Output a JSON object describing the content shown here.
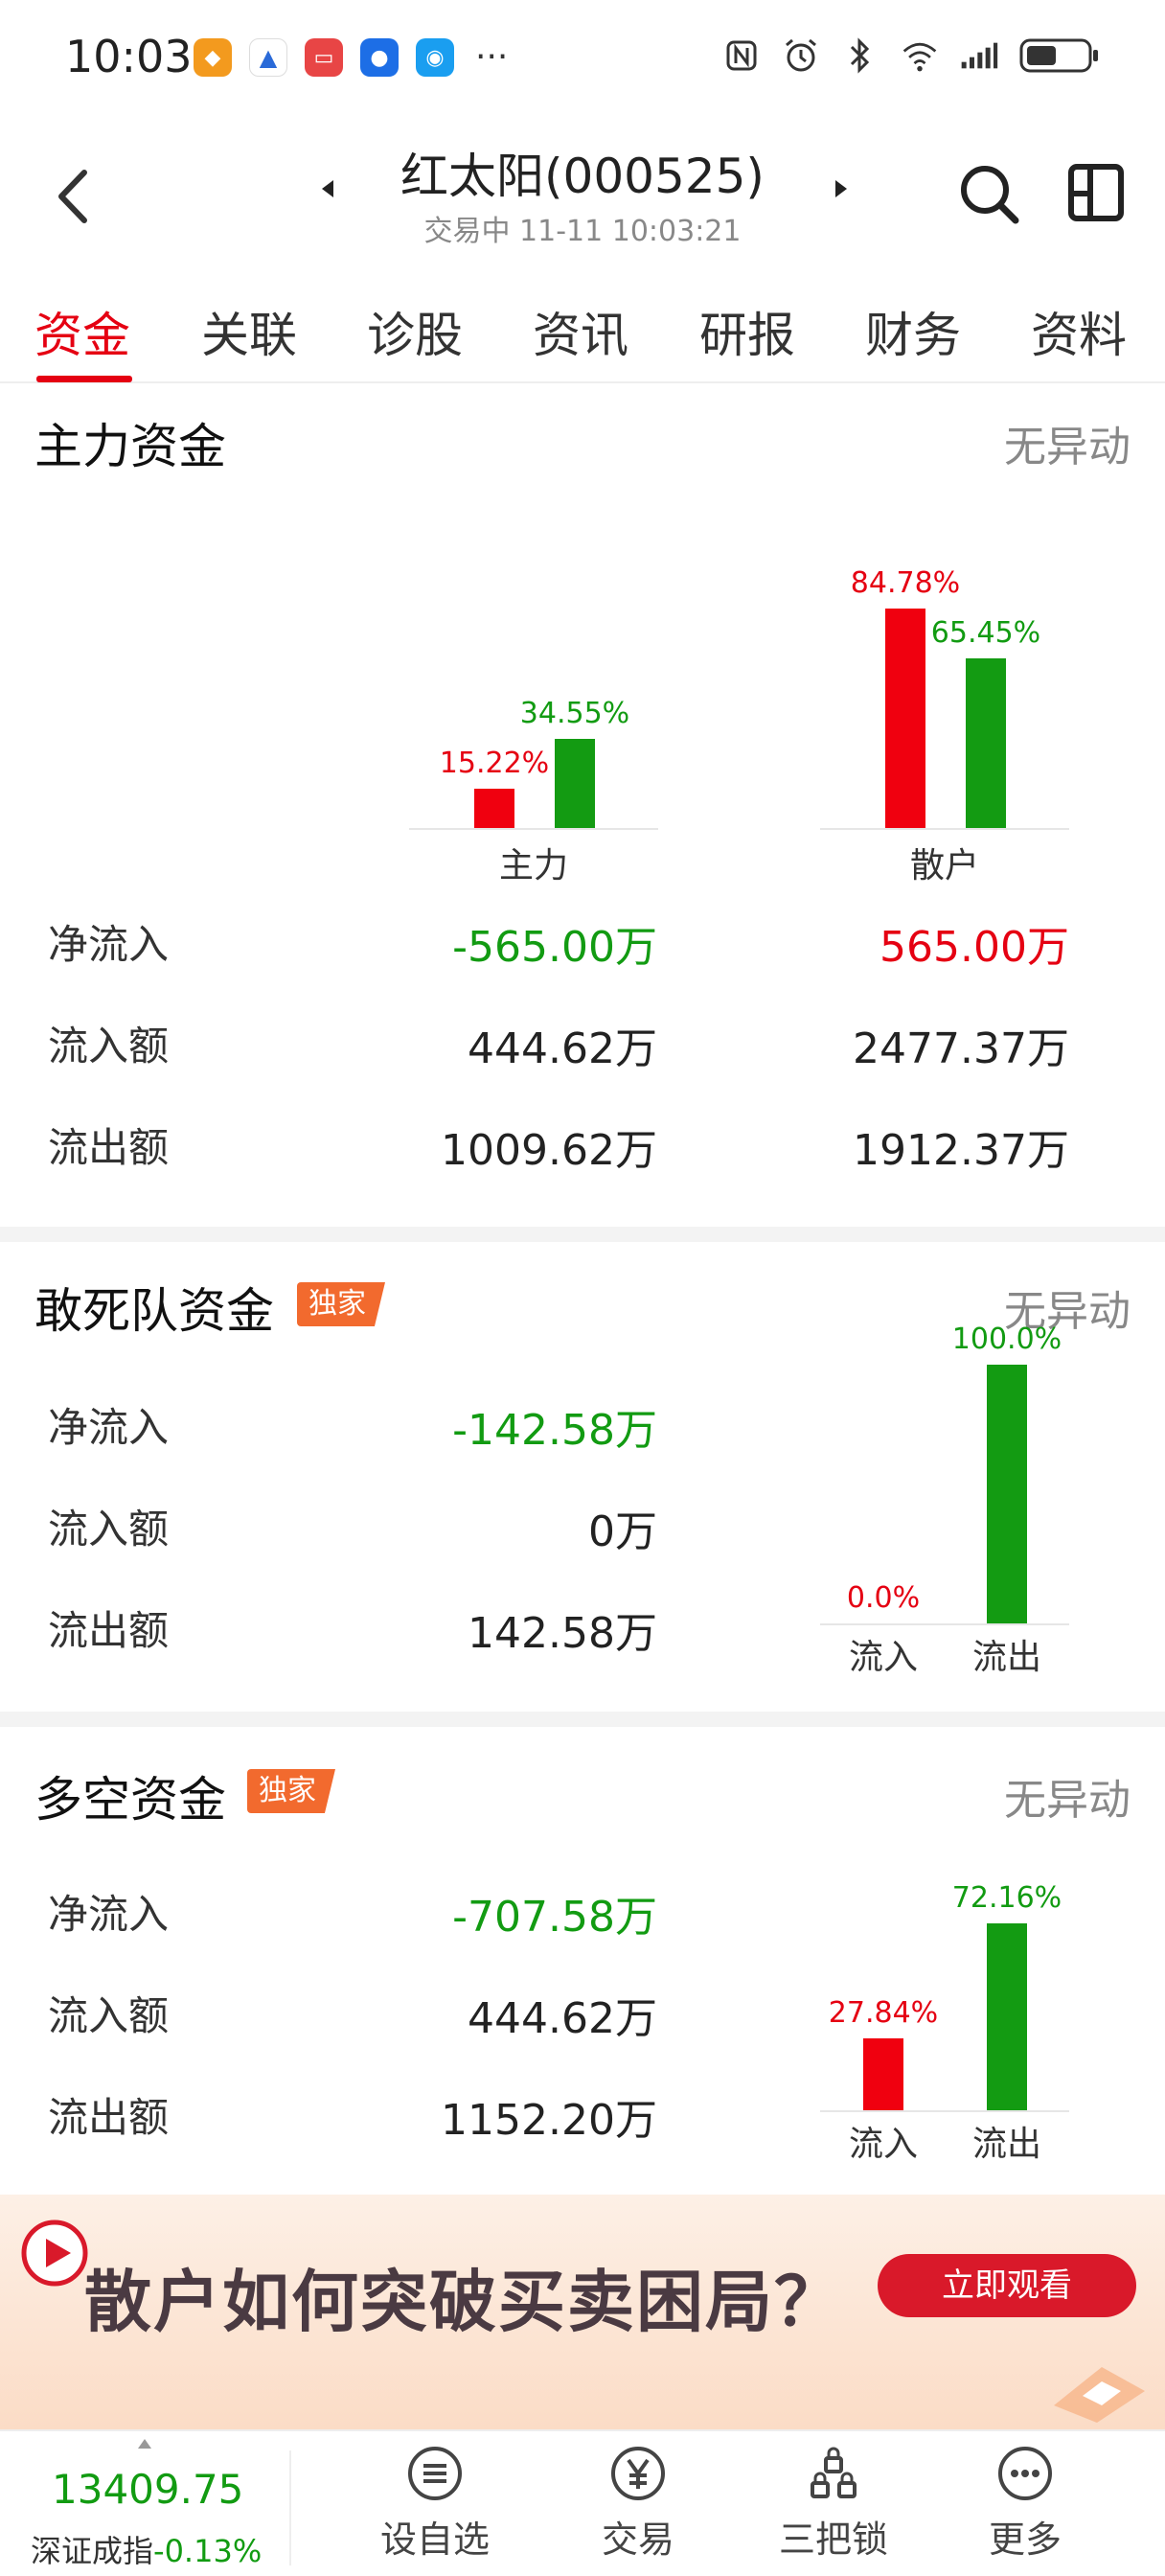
{
  "status_bar": {
    "time": "10:03",
    "more": "···"
  },
  "header": {
    "title": "红太阳(000525)",
    "subtitle": "交易中 11-11 10:03:21"
  },
  "tabs": [
    {
      "label": "资金"
    },
    {
      "label": "关联"
    },
    {
      "label": "诊股"
    },
    {
      "label": "资讯"
    },
    {
      "label": "研报"
    },
    {
      "label": "财务"
    },
    {
      "label": "资料"
    }
  ],
  "main_capital": {
    "title": "主力资金",
    "status": "无异动",
    "rows": [
      {
        "label": "净流入",
        "main": "-565.00万",
        "retail": "565.00万"
      },
      {
        "label": "流入额",
        "main": "444.62万",
        "retail": "2477.37万"
      },
      {
        "label": "流出额",
        "main": "1009.62万",
        "retail": "1912.37万"
      }
    ]
  },
  "dare_squad": {
    "title": "敢死队资金",
    "badge": "独家",
    "status": "无异动",
    "rows": [
      {
        "label": "净流入",
        "value": "-142.58万"
      },
      {
        "label": "流入额",
        "value": "0万"
      },
      {
        "label": "流出额",
        "value": "142.58万"
      }
    ]
  },
  "long_short": {
    "title": "多空资金",
    "badge": "独家",
    "status": "无异动",
    "rows": [
      {
        "label": "净流入",
        "value": "-707.58万"
      },
      {
        "label": "流入额",
        "value": "444.62万"
      },
      {
        "label": "流出额",
        "value": "1152.20万"
      }
    ]
  },
  "chart_data": [
    {
      "type": "bar",
      "categories": [
        "主力",
        "散户"
      ],
      "series": [
        {
          "values": [
            15.22,
            84.78
          ],
          "color": "#f0000f"
        },
        {
          "values": [
            34.55,
            65.45
          ],
          "color": "#139b12"
        }
      ],
      "data_labels": [
        [
          "15.22%",
          "84.78%"
        ],
        [
          "34.55%",
          "65.45%"
        ]
      ]
    },
    {
      "type": "bar",
      "categories": [
        "流入",
        "流出"
      ],
      "values": [
        0.0,
        100.0
      ],
      "data_labels": [
        "0.0%",
        "100.0%"
      ],
      "colors": [
        "#f0000f",
        "#139b12"
      ]
    },
    {
      "type": "bar",
      "categories": [
        "流入",
        "流出"
      ],
      "values": [
        27.84,
        72.16
      ],
      "data_labels": [
        "27.84%",
        "72.16%"
      ],
      "colors": [
        "#f0000f",
        "#139b12"
      ]
    }
  ],
  "banner": {
    "text": "散户如何突破买卖困局？",
    "button": "立即观看"
  },
  "bottom_bar": {
    "index_value": "13409.75",
    "index_name": "深证成指",
    "index_change": "-0.13%",
    "nav": [
      {
        "label": "设自选",
        "icon": "list-icon"
      },
      {
        "label": "交易",
        "icon": "yuan-icon"
      },
      {
        "label": "三把锁",
        "icon": "locks-icon"
      },
      {
        "label": "更多",
        "icon": "more-dots-icon"
      }
    ]
  }
}
